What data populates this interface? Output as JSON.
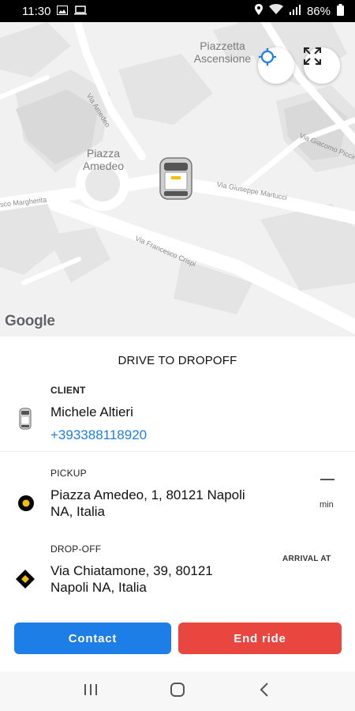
{
  "status_bar": {
    "time": "11:30",
    "battery": "86%"
  },
  "map": {
    "places": [
      "Piazzetta Ascensione",
      "Piazza Amedeo"
    ],
    "streets": [
      "Via Giuseppe Martucci",
      "Via Francesco Crispi",
      "Via Amedeo",
      "Via Giacomo Piccinni",
      "sco Margherita"
    ],
    "attribution": "Google"
  },
  "trip": {
    "title": "DRIVE TO DROPOFF",
    "client": {
      "label": "CLIENT",
      "name": "Michele  Altieri",
      "phone": "+393388118920"
    },
    "pickup": {
      "label": "PICKUP",
      "address_line1": "Piazza Amedeo, 1, 80121 Napoli",
      "address_line2": "NA, Italia",
      "eta_value": "—",
      "eta_unit": "min"
    },
    "dropoff": {
      "label": "DROP-OFF",
      "address_line1": "Via Chiatamone, 39, 80121",
      "address_line2": "Napoli NA, Italia",
      "arrival_label": "ARRIVAL AT"
    }
  },
  "actions": {
    "contact_label": "Contact",
    "end_ride_label": "End ride"
  },
  "colors": {
    "primary_blue": "#1e7ee8",
    "danger_red": "#e8463f",
    "marker_yellow": "#f5c000"
  },
  "icons": {
    "recenter": "crosshair-icon",
    "fullscreen": "fullscreen-icon",
    "client": "car-icon",
    "pickup": "pickup-marker-icon",
    "dropoff": "dropoff-marker-icon"
  }
}
